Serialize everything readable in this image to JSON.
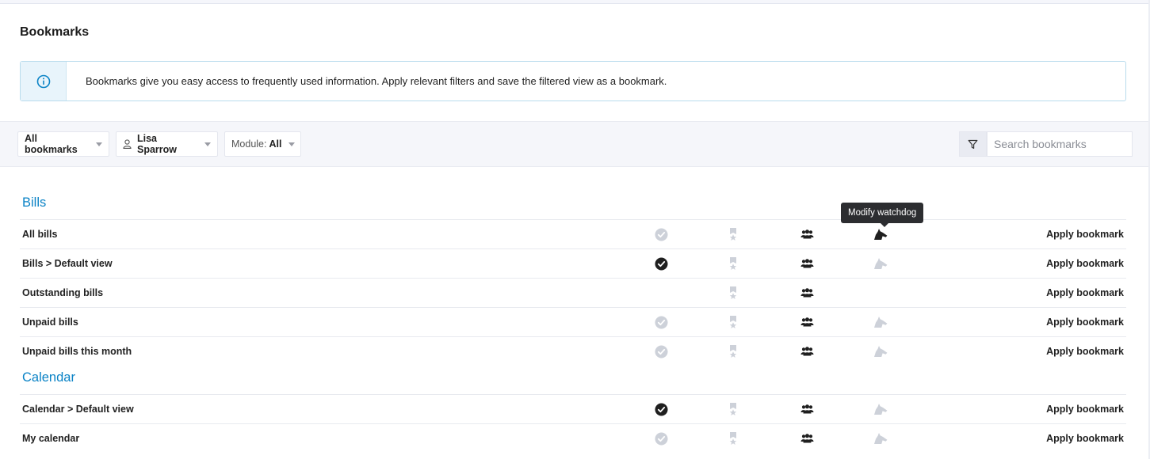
{
  "page": {
    "title": "Bookmarks"
  },
  "info": {
    "text": "Bookmarks give you easy access to frequently used information. Apply relevant filters and save the filtered view as a bookmark."
  },
  "filters": {
    "scope": "All bookmarks",
    "user": "Lisa Sparrow",
    "module_label": "Module:",
    "module_value": "All",
    "search_placeholder": "Search bookmarks"
  },
  "groups": [
    {
      "title": "Bills",
      "rows": [
        {
          "name": "All bills",
          "check": "inactive",
          "watchdog": "active",
          "apply": "Apply bookmark"
        },
        {
          "name": "Bills > Default view",
          "check": "active",
          "watchdog": "inactive",
          "apply": "Apply bookmark"
        },
        {
          "name": "Outstanding bills",
          "check": "none",
          "watchdog": "none",
          "apply": "Apply bookmark"
        },
        {
          "name": "Unpaid bills",
          "check": "inactive",
          "watchdog": "inactive",
          "apply": "Apply bookmark"
        },
        {
          "name": "Unpaid bills this month",
          "check": "inactive",
          "watchdog": "inactive",
          "apply": "Apply bookmark"
        }
      ]
    },
    {
      "title": "Calendar",
      "rows": [
        {
          "name": "Calendar > Default view",
          "check": "active",
          "watchdog": "inactive",
          "apply": "Apply bookmark"
        },
        {
          "name": "My calendar",
          "check": "inactive",
          "watchdog": "inactive",
          "apply": "Apply bookmark"
        }
      ]
    }
  ],
  "tooltip": {
    "text": "Modify watchdog"
  },
  "colors": {
    "accent": "#0b83c6",
    "icon_active": "#1f1f1f",
    "icon_inactive": "#cdd1d9"
  },
  "icons": {
    "check": "check-circle-icon",
    "pin": "pin-star-icon",
    "share": "people-icon",
    "watchdog": "dog-icon",
    "info": "info-icon",
    "filter": "funnel-icon",
    "user": "user-icon"
  }
}
